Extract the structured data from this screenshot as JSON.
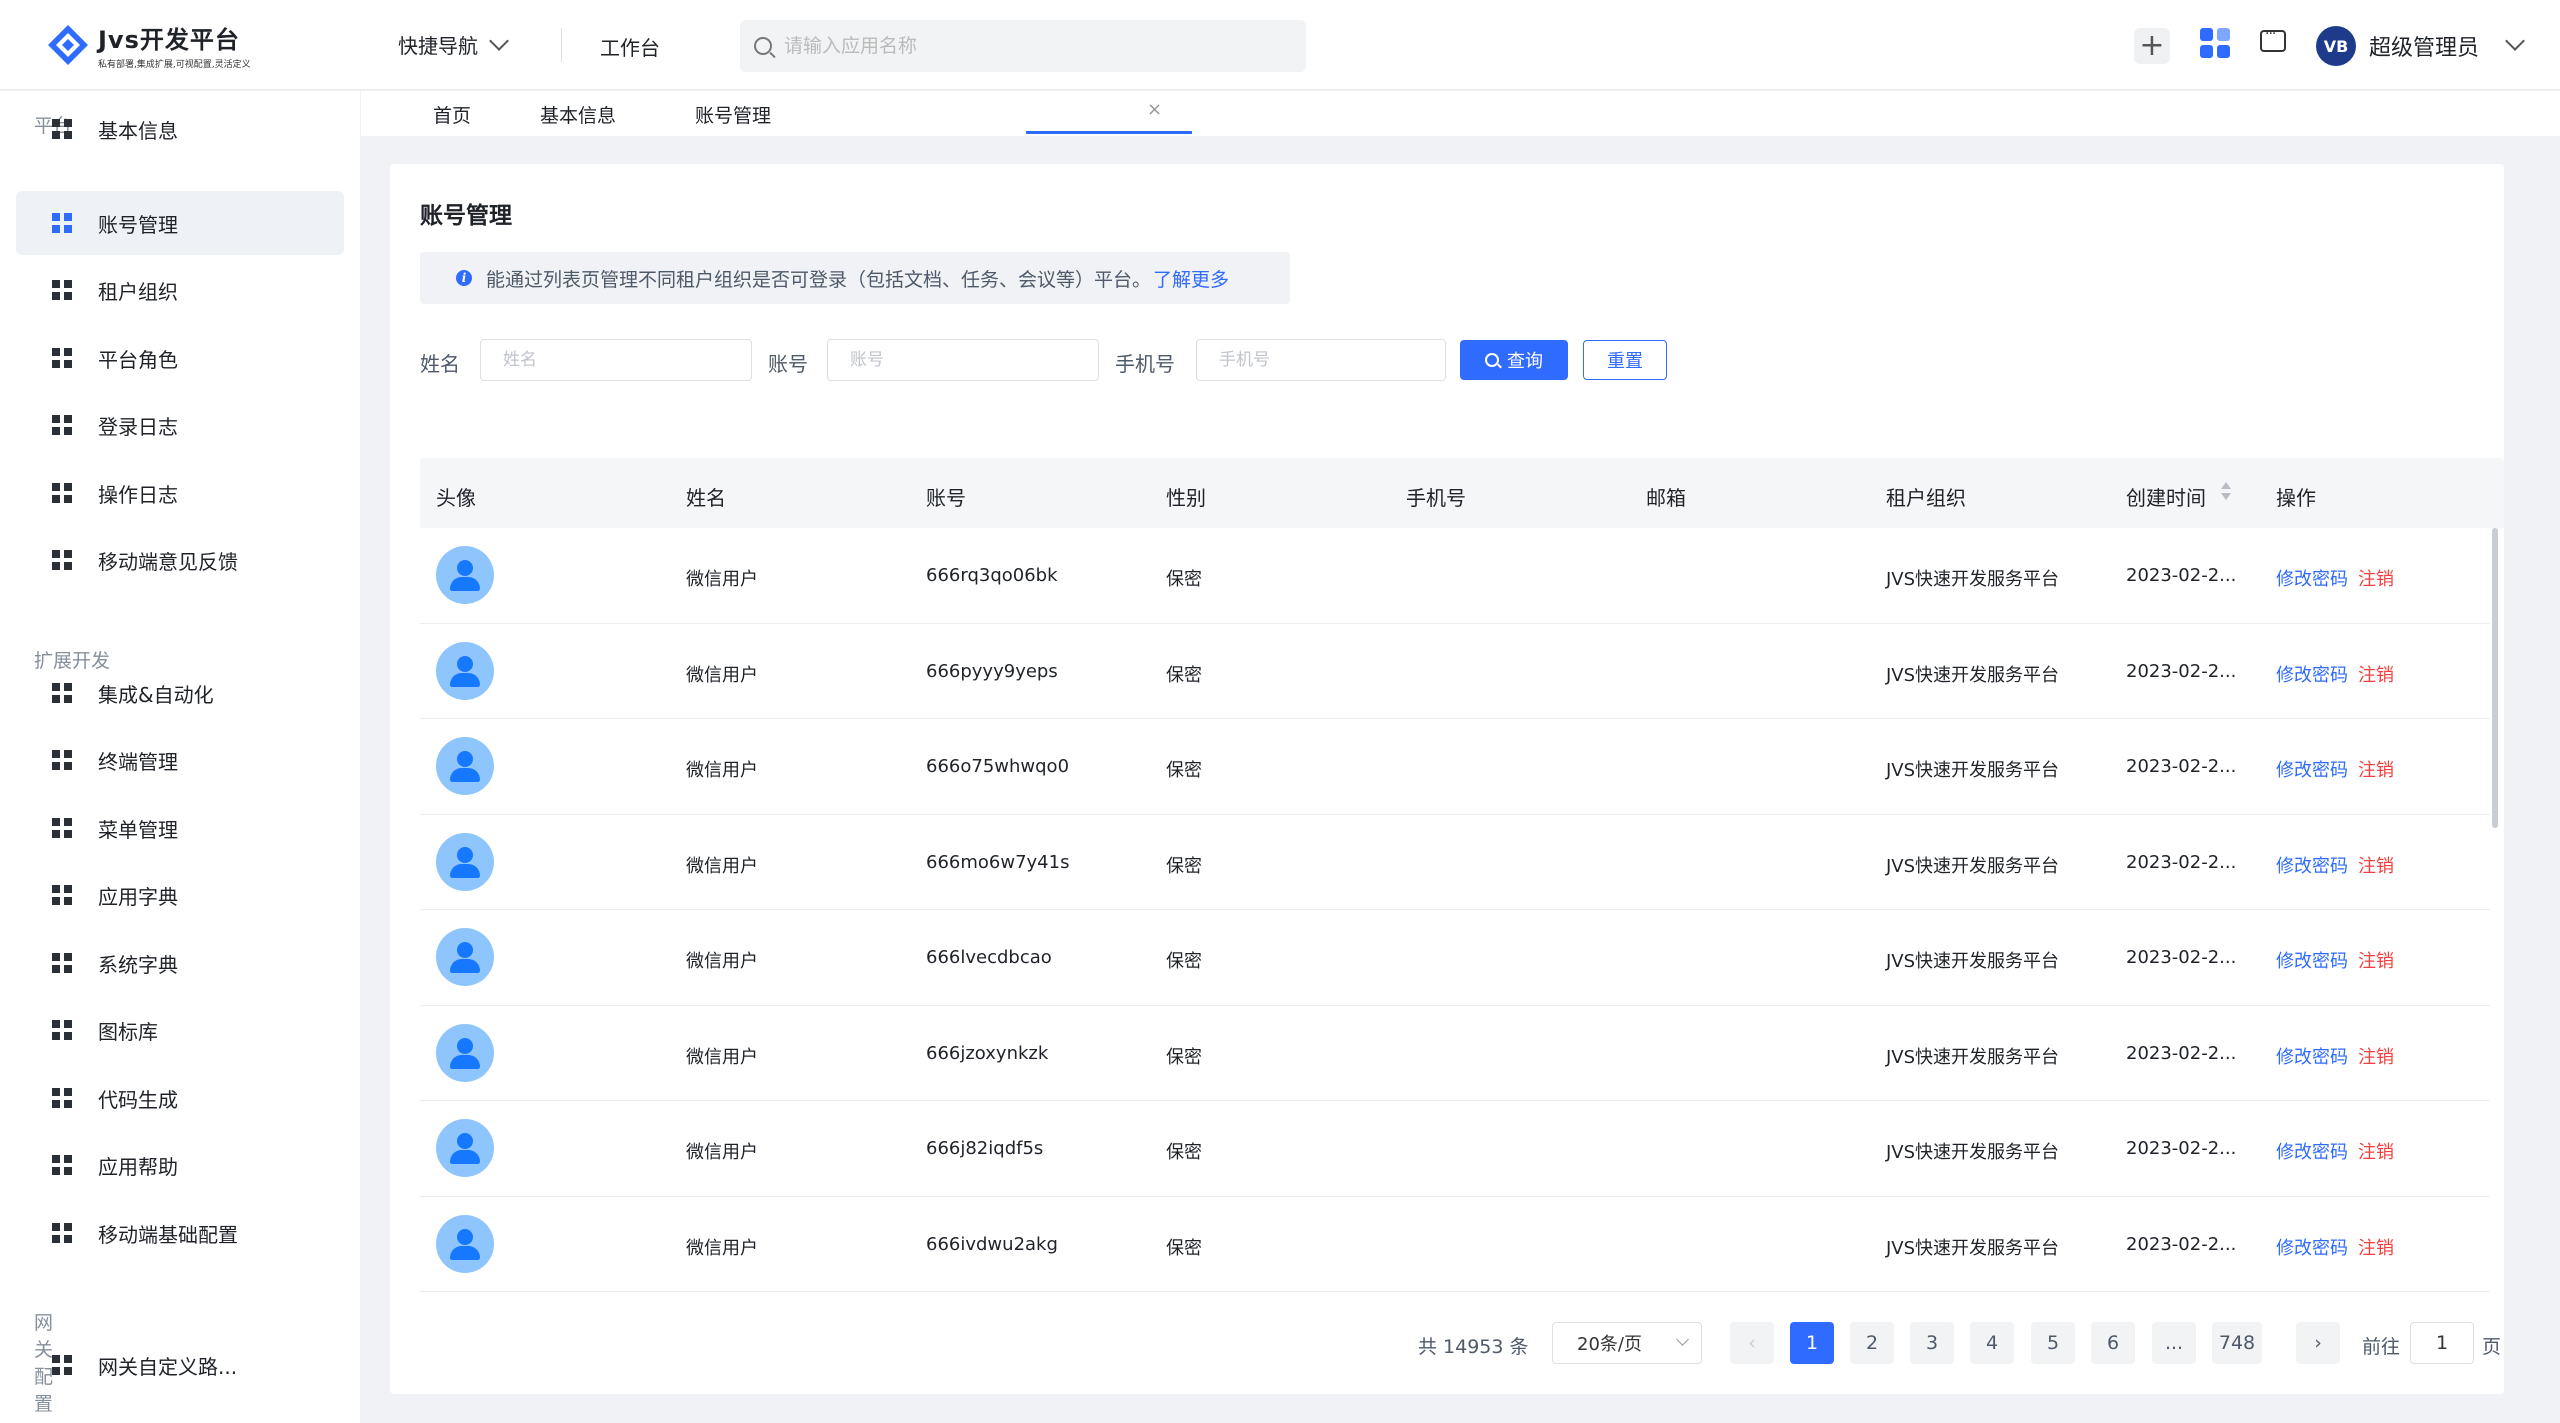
{
  "header": {
    "logo_title": "Jvs开发平台",
    "logo_subtitle": "私有部署,集成扩展,可视配置,灵活定义",
    "quick_nav": "快捷导航",
    "workbench": "工作台",
    "search_placeholder": "请输入应用名称",
    "avatar_text": "VB",
    "user_name": "超级管理员",
    "plus": "+"
  },
  "sidebar": {
    "groups": [
      "平台",
      "扩展开发",
      "网关配置"
    ],
    "items": [
      {
        "label": "基本信息"
      },
      {
        "label": "账号管理"
      },
      {
        "label": "租户组织"
      },
      {
        "label": "平台角色"
      },
      {
        "label": "登录日志"
      },
      {
        "label": "操作日志"
      },
      {
        "label": "移动端意见反馈"
      },
      {
        "label": "集成&自动化"
      },
      {
        "label": "终端管理"
      },
      {
        "label": "菜单管理"
      },
      {
        "label": "应用字典"
      },
      {
        "label": "系统字典"
      },
      {
        "label": "图标库"
      },
      {
        "label": "代码生成"
      },
      {
        "label": "应用帮助"
      },
      {
        "label": "移动端基础配置"
      },
      {
        "label": "网关自定义路..."
      }
    ]
  },
  "tabs": [
    {
      "label": "首页"
    },
    {
      "label": "基本信息"
    },
    {
      "label": "账号管理"
    }
  ],
  "page": {
    "title": "账号管理",
    "notice_text": "能通过列表页管理不同租户组织是否可登录（包括文档、任务、会议等）平台。",
    "notice_link": "了解更多",
    "info_icon": "i"
  },
  "filters": {
    "name_label": "姓名",
    "name_placeholder": "姓名",
    "account_label": "账号",
    "account_placeholder": "账号",
    "phone_label": "手机号",
    "phone_placeholder": "手机号",
    "query_button": "查询",
    "reset_button": "重置"
  },
  "table": {
    "columns": [
      "头像",
      "姓名",
      "账号",
      "性别",
      "手机号",
      "邮箱",
      "租户组织",
      "创建时间",
      "操作"
    ],
    "rows": [
      {
        "name": "微信用户",
        "account": "666rq3qo06bk",
        "gender": "保密",
        "phone": "",
        "email": "",
        "org": "JVS快速开发服务平台",
        "created": "2023-02-2...",
        "edit": "修改密码",
        "cancel": "注销"
      },
      {
        "name": "微信用户",
        "account": "666pyyy9yeps",
        "gender": "保密",
        "phone": "",
        "email": "",
        "org": "JVS快速开发服务平台",
        "created": "2023-02-2...",
        "edit": "修改密码",
        "cancel": "注销"
      },
      {
        "name": "微信用户",
        "account": "666o75whwqo0",
        "gender": "保密",
        "phone": "",
        "email": "",
        "org": "JVS快速开发服务平台",
        "created": "2023-02-2...",
        "edit": "修改密码",
        "cancel": "注销"
      },
      {
        "name": "微信用户",
        "account": "666mo6w7y41s",
        "gender": "保密",
        "phone": "",
        "email": "",
        "org": "JVS快速开发服务平台",
        "created": "2023-02-2...",
        "edit": "修改密码",
        "cancel": "注销"
      },
      {
        "name": "微信用户",
        "account": "666lvecdbcao",
        "gender": "保密",
        "phone": "",
        "email": "",
        "org": "JVS快速开发服务平台",
        "created": "2023-02-2...",
        "edit": "修改密码",
        "cancel": "注销"
      },
      {
        "name": "微信用户",
        "account": "666jzoxynkzk",
        "gender": "保密",
        "phone": "",
        "email": "",
        "org": "JVS快速开发服务平台",
        "created": "2023-02-2...",
        "edit": "修改密码",
        "cancel": "注销"
      },
      {
        "name": "微信用户",
        "account": "666j82iqdf5s",
        "gender": "保密",
        "phone": "",
        "email": "",
        "org": "JVS快速开发服务平台",
        "created": "2023-02-2...",
        "edit": "修改密码",
        "cancel": "注销"
      },
      {
        "name": "微信用户",
        "account": "666ivdwu2akg",
        "gender": "保密",
        "phone": "",
        "email": "",
        "org": "JVS快速开发服务平台",
        "created": "2023-02-2...",
        "edit": "修改密码",
        "cancel": "注销"
      }
    ]
  },
  "pagination": {
    "total": "共 14953 条",
    "page_size": "20条/页",
    "pages": [
      "1",
      "2",
      "3",
      "4",
      "5",
      "6",
      "...",
      "748"
    ],
    "current": "1",
    "prev": "‹",
    "next": "›",
    "goto_label": "前往",
    "goto_value": "1",
    "page_suffix": "页"
  },
  "colors": {
    "accent": "#2f6bff",
    "danger": "#f53f3f",
    "avatar_bg": "#8ec5fc"
  }
}
